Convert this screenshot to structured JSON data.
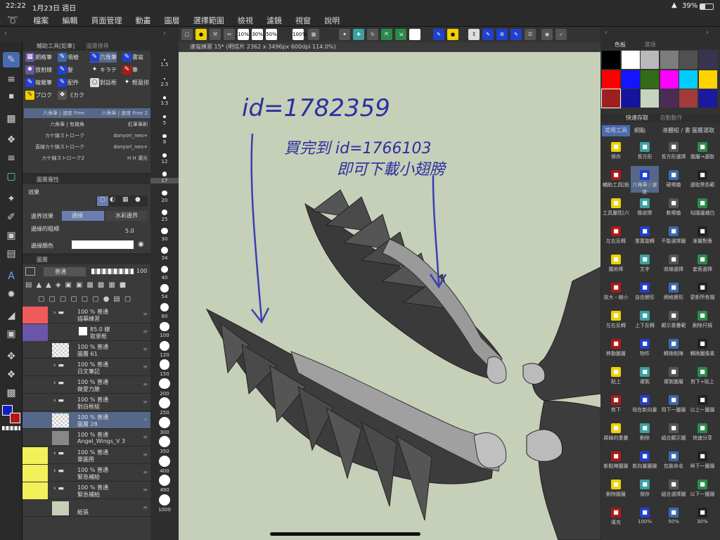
{
  "status": {
    "time": "22:22",
    "date": "1月23日 週日",
    "battery": "39%"
  },
  "menu": [
    "檔案",
    "編輯",
    "頁面管理",
    "動畫",
    "圖層",
    "選擇範圍",
    "檢視",
    "濾鏡",
    "視窗",
    "說明"
  ],
  "command_bar": {
    "zoom_labels": [
      "10%",
      "30%",
      "50%",
      "100%"
    ]
  },
  "subtool_panel": {
    "title": "輔助工具[鉛筆]",
    "tab2": "圖層搜尋",
    "subtools": [
      "網格筆",
      "噴槍",
      "六角筆",
      "書寫",
      "放射線",
      "髮",
      "キラテ",
      "筆",
      "複雜筆",
      "配件",
      "對話框",
      "輕盈排",
      "プロク",
      "《カク"
    ],
    "brushes": [
      [
        "六角筆 | 速度 Free",
        "六角筆 | 速度 Free 2"
      ],
      [
        "六角筆 | 有機角",
        "紅筆筆刷"
      ],
      [
        "カケ線ストローク",
        "donyori_neo+"
      ],
      [
        "直線カケ線ストローク",
        "donyori_neo+"
      ],
      [
        "カケ線ストローク2",
        "H H 濃光"
      ]
    ]
  },
  "property_panel": {
    "title": "圖層屬性",
    "effect_label": "效果",
    "border_effect_label": "邊界效果",
    "border_option1": "邊緣",
    "border_option2": "水彩邊界",
    "border_width_label": "邊緣的粗細",
    "border_width_value": "5.0",
    "border_color_label": "邊緣顏色"
  },
  "layer_panel": {
    "title": "圖層",
    "blend_mode": "普通",
    "opacity": "100",
    "layers": [
      {
        "line1": "100 % 普通",
        "line2": "描摹練習",
        "v1": "#f05a5a",
        "v2": "#f05a5a",
        "kind": "folder"
      },
      {
        "line1": "85.0 線",
        "line2": "取景框",
        "v1": "#6a55a8",
        "v2": "#6a55a8",
        "kind": "frame"
      },
      {
        "line1": "100 % 普通",
        "line2": "圖層 61",
        "v1": "",
        "v2": "",
        "kind": "raster"
      },
      {
        "line1": "100 % 普通",
        "line2": "日文筆記",
        "v1": "",
        "v2": "",
        "kind": "folder"
      },
      {
        "line1": "100 % 普通",
        "line2": "做愛力臉",
        "v1": "",
        "v2": "",
        "kind": "folder"
      },
      {
        "line1": "100 % 普通",
        "line2": "對白框組",
        "v1": "",
        "v2": "",
        "kind": "folder"
      },
      {
        "line1": "100 % 普通",
        "line2": "圖層 28",
        "v1": "",
        "v2": "",
        "kind": "selected"
      },
      {
        "line1": "100 % 普通",
        "line2": "Angel_Wings_V 3",
        "v1": "",
        "v2": "",
        "kind": "3d"
      },
      {
        "line1": "100 % 普通",
        "line2": "單圖用",
        "v1": "#f3f05a",
        "v2": "#f3f05a",
        "kind": "folder"
      },
      {
        "line1": "100 % 普通",
        "line2": "緊急補給",
        "v1": "#f3f05a",
        "v2": "#f3f05a",
        "kind": "folder"
      },
      {
        "line1": "100 % 普通",
        "line2": "緊急補給",
        "v1": "#f3f05a",
        "v2": "#f3f05a",
        "kind": "folder"
      },
      {
        "line1": "",
        "line2": "紙張",
        "v1": "",
        "v2": "",
        "kind": "paper"
      }
    ]
  },
  "brush_size_ruler": [
    "1.5",
    "2.5",
    "3.5",
    "5",
    "8",
    "12",
    "17",
    "20",
    "25",
    "30",
    "34",
    "40",
    "54",
    "60",
    "100",
    "120",
    "150",
    "200",
    "250",
    "300",
    "350",
    "400",
    "490",
    "1000"
  ],
  "canvas": {
    "title": "速寫練習 15* (明信片 2362 x 3496px 600dpi 114.0%)",
    "note1": "id=1782359",
    "note2": "買完到 id=1766103",
    "note3": "即可下載小翅膀"
  },
  "color_panel": {
    "title": "色板",
    "tab2": "選項",
    "swatches": [
      "#000000",
      "#ffffff",
      "#b9b9b9",
      "#7d7d7d",
      "#505050",
      "#3a3350",
      "#ff0000",
      "#1414ff",
      "#336c18",
      "#ff00ff",
      "#00ccff",
      "#ffd300",
      "#9e1f1f",
      "#15149e",
      "#c5d4c0",
      "#4a2c54",
      "#a23b3b",
      "#1a1aa0"
    ]
  },
  "quick_access": {
    "title": "快速存取",
    "tab2": "自動動作",
    "tabs": [
      "常用工具",
      "網點",
      "液體組 / 書",
      "圖層選取"
    ],
    "items": [
      "保存",
      "長方形",
      "長方形選擇",
      "圖層→選取",
      "輔助工具[鉛",
      "六角筆 / 速度",
      "硬噴槍",
      "選取黑色範",
      "工具屬性[六",
      "橡皮擦",
      "軟噴槍",
      "勾描邊補白",
      "左右反轉",
      "重置旋轉",
      "不能選擇圖",
      "漸層對應",
      "魔術棒",
      "文字",
      "收縮選擇",
      "套索選擇",
      "放大・縮小",
      "自由變形",
      "網格變形",
      "更新所有檔",
      "左右反轉",
      "上下反轉",
      "顯示重疊範",
      "刪除尺規",
      "移動圖層",
      "物件",
      "轉換點陣",
      "轉換圖像素",
      "貼上",
      "複製",
      "複製圖層",
      "剪下+貼上",
      "剪下",
      "貼在新向量",
      "用下一圖層",
      "以上一圖層",
      "將線的重疊",
      "刪除",
      "組合顯示圖",
      "快速分享",
      "新點陣圖層",
      "新向量圖層",
      "包裝命名",
      "與下一圖層",
      "刪除圖層",
      "保存",
      "組合選擇圖",
      "以下一圖層",
      "填充",
      "100%",
      "50%",
      "30%"
    ]
  },
  "colors": {
    "fg": "#1020c0",
    "bg": "#b01818"
  }
}
